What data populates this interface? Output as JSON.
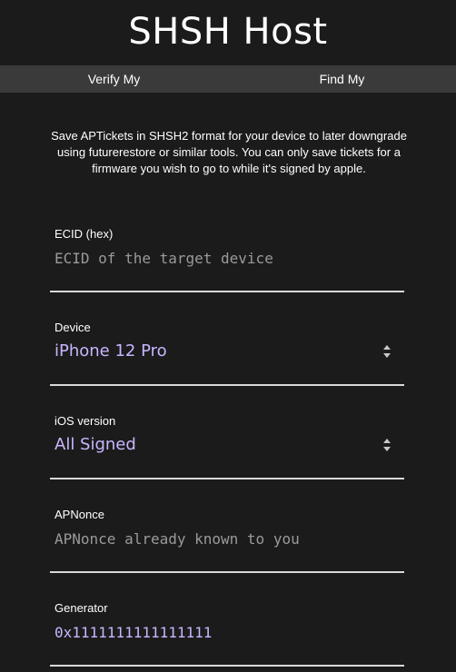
{
  "header": {
    "title": "SHSH Host"
  },
  "nav": {
    "items": [
      {
        "label": "Verify My"
      },
      {
        "label": "Find My"
      }
    ]
  },
  "intro": {
    "text": "Save APTickets in SHSH2 format for your device to later downgrade using futurerestore or similar tools. You can only save tickets for a firmware you wish to go to while it's signed by apple."
  },
  "form": {
    "ecid": {
      "label": "ECID (hex)",
      "value": "",
      "placeholder": "ECID of the target device"
    },
    "device": {
      "label": "Device",
      "selected": "iPhone 12 Pro"
    },
    "ios": {
      "label": "iOS version",
      "selected": "All Signed"
    },
    "apnonce": {
      "label": "APNonce",
      "value": "",
      "placeholder": "APNonce already known to you"
    },
    "generator": {
      "label": "Generator",
      "value": "0x1111111111111111",
      "placeholder": ""
    }
  },
  "colors": {
    "background": "#1b1b1b",
    "nav_background": "#3a3a3a",
    "accent": "#c9b6ff",
    "placeholder": "#9a9a9a",
    "divider": "#d9d9d9"
  }
}
